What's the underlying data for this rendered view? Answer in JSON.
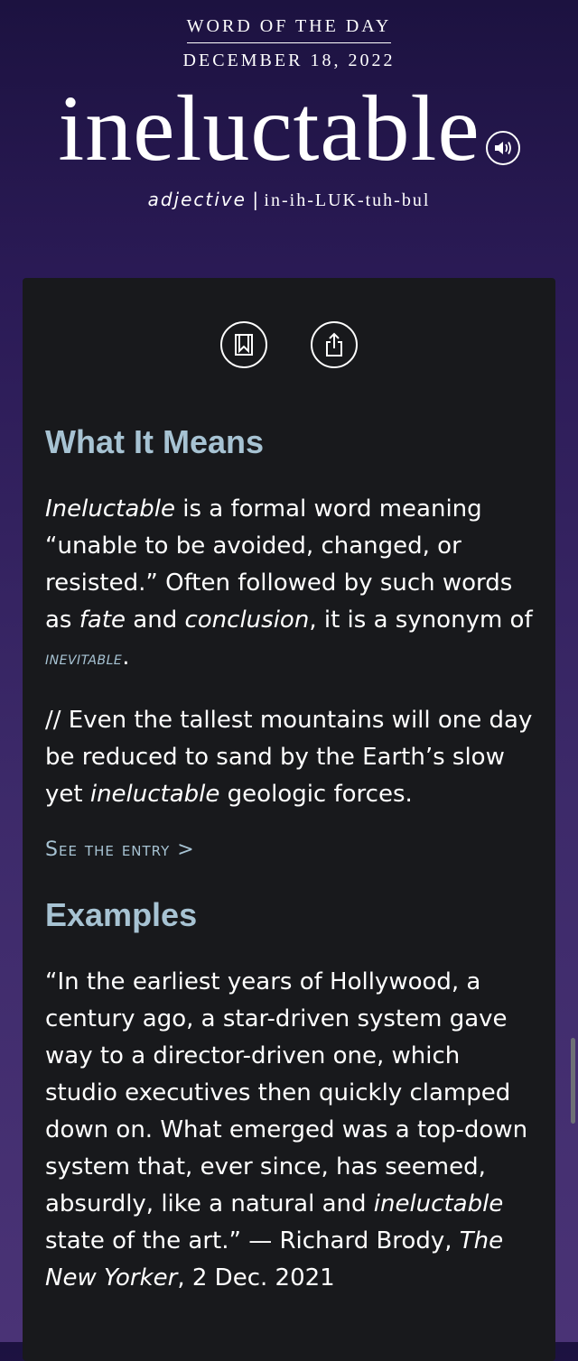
{
  "header": {
    "label": "WORD OF THE DAY",
    "date": "DECEMBER 18, 2022",
    "word": "ineluctable",
    "part_of_speech": "adjective",
    "separator": "|",
    "pronunciation": "in-ih-LUK-tuh-bul",
    "audio_icon": "speaker-icon"
  },
  "card": {
    "icons": [
      "bookmark-icon",
      "share-icon"
    ],
    "meaning": {
      "heading": "What It Means",
      "def_word": "Ineluctable",
      "def_1": " is a formal word meaning “unable to be avoided, changed, or resisted.” Often followed by such words as ",
      "def_fate": "fate",
      "def_and": " and ",
      "def_conclusion": "conclusion",
      "def_2": ", it is a synonym of ",
      "synonym": "inevitable",
      "def_end": ".",
      "example_1": "// Even the tallest mountains will one day be reduced to sand by the Earth’s slow yet ",
      "example_word": "ineluctable",
      "example_2": " geologic forces.",
      "see_entry": "See the entry >"
    },
    "examples": {
      "heading": "Examples",
      "quote_1": "“In the earliest years of Hollywood, a century ago, a star-driven system gave way to a director-driven one, which studio executives then quickly clamped down on. What emerged was a top-down system that, ever since, has seemed, absurdly, like a natural and ",
      "quote_word": "ineluctable",
      "quote_2": " state of the art.” — Richard Brody, ",
      "source": "The New Yorker",
      "quote_3": ", 2 Dec. 2021"
    }
  },
  "colors": {
    "accent": "#a7c3d3",
    "card_bg": "#18191c",
    "bg_top": "#1c1240",
    "bg_bottom": "#4a3376"
  }
}
